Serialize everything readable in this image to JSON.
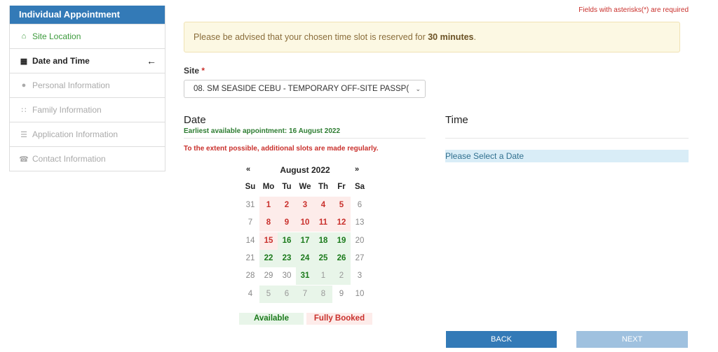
{
  "sidebar": {
    "title": "Individual Appointment",
    "items": [
      {
        "label": "Site Location",
        "icon": "home-icon",
        "glyph": "⌂",
        "state": "done"
      },
      {
        "label": "Date and Time",
        "icon": "calendar-icon",
        "glyph": "▦",
        "state": "active"
      },
      {
        "label": "Personal Information",
        "icon": "user-icon",
        "glyph": "●",
        "state": "disabled"
      },
      {
        "label": "Family Information",
        "icon": "users-icon",
        "glyph": "∷",
        "state": "disabled"
      },
      {
        "label": "Application Information",
        "icon": "list-icon",
        "glyph": "☰",
        "state": "disabled"
      },
      {
        "label": "Contact Information",
        "icon": "phone-icon",
        "glyph": "☎",
        "state": "disabled"
      }
    ],
    "active_arrow": "←"
  },
  "required_note": "Fields with asterisks(*) are required",
  "advisory": {
    "text": "Please be advised that your chosen time slot is reserved for ",
    "bold": "30 minutes",
    "end": "."
  },
  "site": {
    "label": "Site",
    "asterisk": "*",
    "value": "08. SM SEASIDE CEBU - TEMPORARY OFF-SITE PASSP(",
    "chevron": "⌄"
  },
  "date": {
    "title": "Date",
    "earliest": "Earliest available appointment: 16 August 2022",
    "extent_note": "To the extent possible, additional slots are made regularly."
  },
  "time": {
    "title": "Time",
    "message": "Please Select a Date"
  },
  "calendar": {
    "prev": "«",
    "next": "»",
    "month": "August 2022",
    "weekdays": [
      "Su",
      "Mo",
      "Tu",
      "We",
      "Th",
      "Fr",
      "Sa"
    ],
    "weeks": [
      [
        {
          "d": "31",
          "s": "muted"
        },
        {
          "d": "1",
          "s": "booked"
        },
        {
          "d": "2",
          "s": "booked"
        },
        {
          "d": "3",
          "s": "booked"
        },
        {
          "d": "4",
          "s": "booked"
        },
        {
          "d": "5",
          "s": "booked"
        },
        {
          "d": "6",
          "s": "muted"
        }
      ],
      [
        {
          "d": "7",
          "s": "muted"
        },
        {
          "d": "8",
          "s": "booked"
        },
        {
          "d": "9",
          "s": "booked"
        },
        {
          "d": "10",
          "s": "booked"
        },
        {
          "d": "11",
          "s": "booked"
        },
        {
          "d": "12",
          "s": "booked"
        },
        {
          "d": "13",
          "s": "muted"
        }
      ],
      [
        {
          "d": "14",
          "s": "muted"
        },
        {
          "d": "15",
          "s": "booked"
        },
        {
          "d": "16",
          "s": "available"
        },
        {
          "d": "17",
          "s": "available"
        },
        {
          "d": "18",
          "s": "available"
        },
        {
          "d": "19",
          "s": "available"
        },
        {
          "d": "20",
          "s": "muted"
        }
      ],
      [
        {
          "d": "21",
          "s": "muted"
        },
        {
          "d": "22",
          "s": "available"
        },
        {
          "d": "23",
          "s": "available"
        },
        {
          "d": "24",
          "s": "available"
        },
        {
          "d": "25",
          "s": "available"
        },
        {
          "d": "26",
          "s": "available"
        },
        {
          "d": "27",
          "s": "muted"
        }
      ],
      [
        {
          "d": "28",
          "s": "muted"
        },
        {
          "d": "29",
          "s": "muted"
        },
        {
          "d": "30",
          "s": "muted"
        },
        {
          "d": "31",
          "s": "available"
        },
        {
          "d": "1",
          "s": "faded"
        },
        {
          "d": "2",
          "s": "faded"
        },
        {
          "d": "3",
          "s": "muted"
        }
      ],
      [
        {
          "d": "4",
          "s": "muted"
        },
        {
          "d": "5",
          "s": "faded"
        },
        {
          "d": "6",
          "s": "faded"
        },
        {
          "d": "7",
          "s": "faded"
        },
        {
          "d": "8",
          "s": "faded"
        },
        {
          "d": "9",
          "s": "muted"
        },
        {
          "d": "10",
          "s": "muted"
        }
      ]
    ]
  },
  "legend": {
    "available": "Available",
    "booked": "Fully Booked"
  },
  "buttons": {
    "back": "BACK",
    "next": "NEXT"
  },
  "colors": {
    "primary": "#337ab7",
    "available": "#1b7a1b",
    "booked": "#c9302c"
  }
}
